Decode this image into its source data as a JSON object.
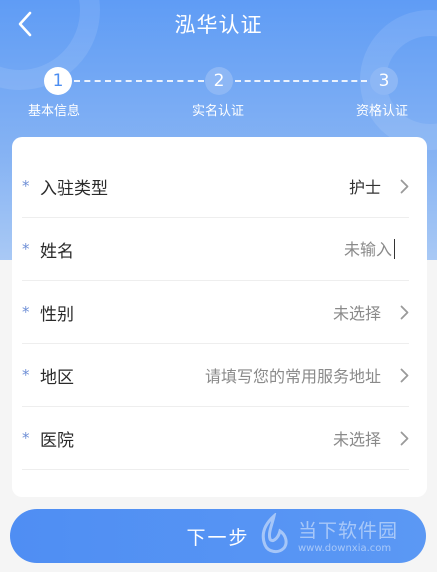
{
  "header": {
    "title": "泓华认证",
    "back_icon": "chevron-left-icon"
  },
  "steps": [
    {
      "number": "1",
      "label": "基本信息",
      "active": true
    },
    {
      "number": "2",
      "label": "实名认证",
      "active": false
    },
    {
      "number": "3",
      "label": "资格认证",
      "active": false
    }
  ],
  "form": {
    "rows": [
      {
        "label": "入驻类型",
        "value": "护士",
        "type": "select"
      },
      {
        "label": "姓名",
        "placeholder": "未输入",
        "type": "input"
      },
      {
        "label": "性别",
        "value": "未选择",
        "type": "select"
      },
      {
        "label": "地区",
        "value": "请填写您的常用服务地址",
        "type": "select"
      },
      {
        "label": "医院",
        "value": "未选择",
        "type": "select"
      }
    ],
    "required_mark": "*"
  },
  "next_button": {
    "label": "下一步"
  },
  "watermark": {
    "text": "当下软件园",
    "url": "www.downxia.com"
  },
  "colors": {
    "accent": "#4f8ef3",
    "header_top": "#5f9cf5",
    "header_bottom": "#a9c9f5"
  }
}
